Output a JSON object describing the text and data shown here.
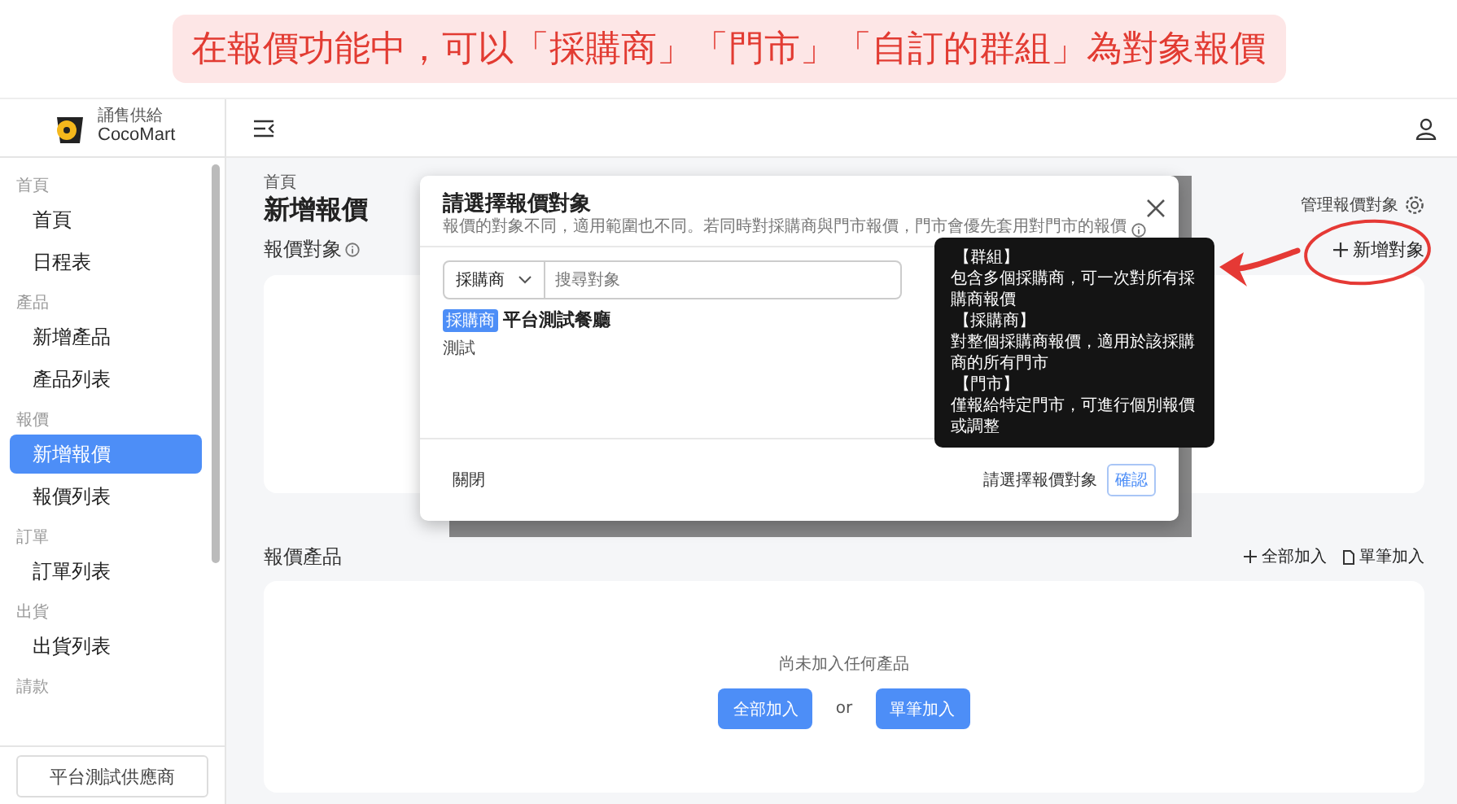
{
  "banner": {
    "text": "在報價功能中，可以「採購商」「門市」「自訂的群組」為對象報價"
  },
  "logo": {
    "tagline": "誦售供給",
    "name": "CocoMart"
  },
  "sidebar": {
    "groups": [
      {
        "label": "首頁",
        "items": [
          {
            "label": "首頁",
            "selected": false
          },
          {
            "label": "日程表",
            "selected": false
          }
        ]
      },
      {
        "label": "產品",
        "items": [
          {
            "label": "新增產品",
            "selected": false
          },
          {
            "label": "產品列表",
            "selected": false
          }
        ]
      },
      {
        "label": "報價",
        "items": [
          {
            "label": "新增報價",
            "selected": true
          },
          {
            "label": "報價列表",
            "selected": false
          }
        ]
      },
      {
        "label": "訂單",
        "items": [
          {
            "label": "訂單列表",
            "selected": false
          }
        ]
      },
      {
        "label": "出貨",
        "items": [
          {
            "label": "出貨列表",
            "selected": false
          }
        ]
      },
      {
        "label": "請款"
      }
    ],
    "account": "平台測試供應商"
  },
  "page": {
    "breadcrumb": "首頁",
    "title": "新增報價",
    "manage_link": "管理報價對象",
    "target_section": {
      "title": "報價對象",
      "add_link": "新增對象"
    },
    "product_section": {
      "title": "報價產品",
      "actions": [
        {
          "label": "全部加入",
          "kind": "plus"
        },
        {
          "label": "單筆加入",
          "kind": "file"
        }
      ],
      "empty_text": "尚未加入任何產品",
      "buttons": [
        "全部加入",
        "單筆加入"
      ],
      "or": "or"
    }
  },
  "modal": {
    "title": "請選擇報價對象",
    "subtitle": "報價的對象不同，適用範圍也不同。若同時對採購商與門市報價，門市會優先套用對門市的報價",
    "type_select": "採購商",
    "search_placeholder": "搜尋對象",
    "results": [
      {
        "tag": "採購商",
        "name": "平台測試餐廳",
        "note": "測試"
      }
    ],
    "close": "關閉",
    "hint": "請選擇報價對象",
    "confirm": "確認"
  },
  "tooltip": {
    "lines": [
      {
        "kind": "heading",
        "text": "【群組】"
      },
      {
        "kind": "text",
        "text": "包含多個採購商，可一次對所有採購商報價"
      },
      {
        "kind": "heading",
        "text": "【採購商】"
      },
      {
        "kind": "text",
        "text": "對整個採購商報價，適用於該採購商的所有門市"
      },
      {
        "kind": "heading",
        "text": "【門市】"
      },
      {
        "kind": "text",
        "text": "僅報給特定門市，可進行個別報價或調整"
      }
    ]
  }
}
